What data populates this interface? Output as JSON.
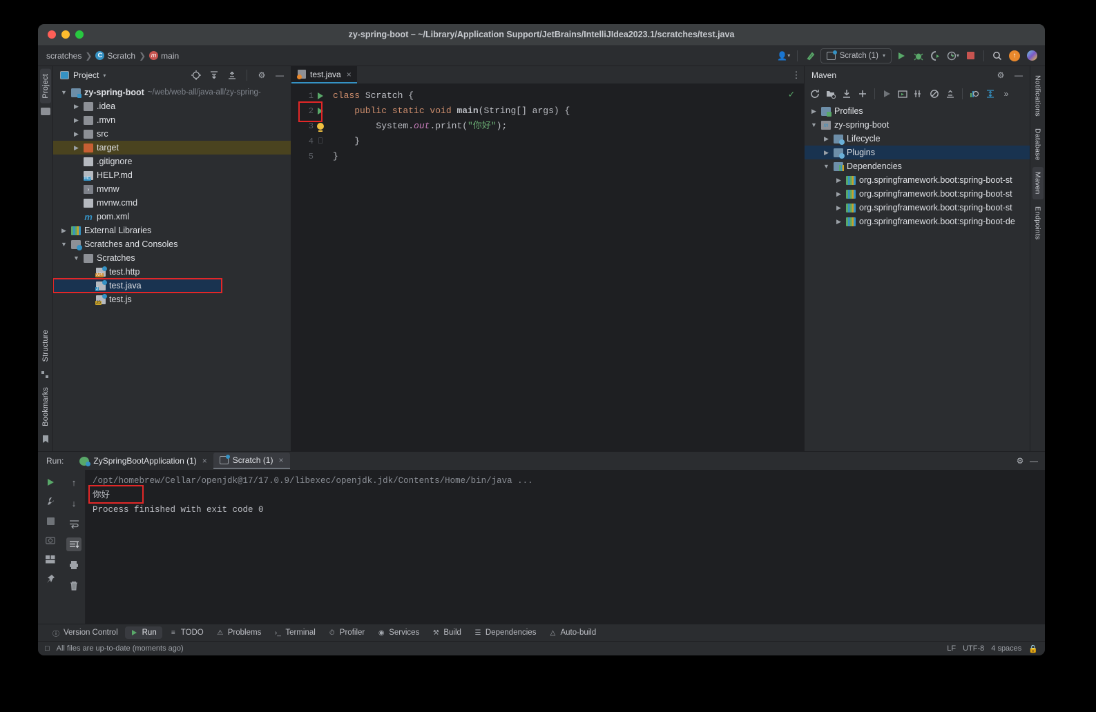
{
  "window": {
    "title": "zy-spring-boot – ~/Library/Application Support/JetBrains/IntelliJIdea2023.1/scratches/test.java"
  },
  "breadcrumbs": [
    {
      "label": "scratches",
      "icon": ""
    },
    {
      "label": "Scratch",
      "icon": "class-icon"
    },
    {
      "label": "main",
      "icon": "method-icon"
    }
  ],
  "toolbar": {
    "run_config": "Scratch (1)",
    "icons": [
      "user-dropdown-icon",
      "build-hammer-icon",
      "run-icon",
      "debug-icon",
      "run-coverage-icon",
      "profiler-icon",
      "stop-icon",
      "search-everywhere-icon",
      "updates-icon",
      "ai-assistant-icon"
    ]
  },
  "left_strip": {
    "tabs": [
      "Project"
    ],
    "bottom_tabs": [
      "Structure",
      "Bookmarks"
    ]
  },
  "right_strip": {
    "tabs": [
      "Notifications",
      "Database",
      "Maven",
      "Endpoints"
    ]
  },
  "project_panel": {
    "title": "Project",
    "toolbar_icons": [
      "select-opened-file-icon",
      "expand-all-icon",
      "collapse-all-icon",
      "settings-gear-icon",
      "hide-icon"
    ],
    "tree": [
      {
        "indent": 0,
        "arrow": "v",
        "icon": "module-icon",
        "label": "zy-spring-boot",
        "bold": true,
        "path": "~/web/web-all/java-all/zy-spring-",
        "state": "normal"
      },
      {
        "indent": 1,
        "arrow": ">",
        "icon": "folder-icon",
        "label": ".idea",
        "state": "normal"
      },
      {
        "indent": 1,
        "arrow": ">",
        "icon": "folder-icon",
        "label": ".mvn",
        "state": "normal"
      },
      {
        "indent": 1,
        "arrow": ">",
        "icon": "folder-icon",
        "label": "src",
        "state": "normal"
      },
      {
        "indent": 1,
        "arrow": ">",
        "icon": "folder-excluded-icon",
        "label": "target",
        "state": "highlighted"
      },
      {
        "indent": 1,
        "arrow": "",
        "icon": "gitignore-icon",
        "label": ".gitignore",
        "state": "normal"
      },
      {
        "indent": 1,
        "arrow": "",
        "icon": "markdown-icon",
        "label": "HELP.md",
        "state": "normal"
      },
      {
        "indent": 1,
        "arrow": "",
        "icon": "shell-script-icon",
        "label": "mvnw",
        "state": "normal"
      },
      {
        "indent": 1,
        "arrow": "",
        "icon": "cmd-script-icon",
        "label": "mvnw.cmd",
        "state": "normal"
      },
      {
        "indent": 1,
        "arrow": "",
        "icon": "maven-xml-icon",
        "label": "pom.xml",
        "state": "normal"
      },
      {
        "indent": 0,
        "arrow": ">",
        "icon": "libraries-icon",
        "label": "External Libraries",
        "state": "normal"
      },
      {
        "indent": 0,
        "arrow": "v",
        "icon": "scratches-root-icon",
        "label": "Scratches and Consoles",
        "state": "normal"
      },
      {
        "indent": 1,
        "arrow": "v",
        "icon": "folder-icon",
        "label": "Scratches",
        "state": "normal"
      },
      {
        "indent": 2,
        "arrow": "",
        "icon": "http-scratch-icon",
        "label": "test.http",
        "tag": "API",
        "state": "normal"
      },
      {
        "indent": 2,
        "arrow": "",
        "icon": "java-scratch-icon",
        "label": "test.java",
        "tag": "J",
        "state": "selected-boxed"
      },
      {
        "indent": 2,
        "arrow": "",
        "icon": "js-scratch-icon",
        "label": "test.js",
        "tag": "JS",
        "state": "normal"
      }
    ]
  },
  "editor": {
    "tab": {
      "label": "test.java",
      "icon": "java-scratch-icon",
      "close": "×"
    },
    "more_icon": "more-vertical-icon",
    "inspection_status": "✓",
    "lines": [
      {
        "num": "1",
        "gutter": "run-gutter-icon",
        "tokens": [
          {
            "t": "class ",
            "c": "kw"
          },
          {
            "t": "Scratch",
            "c": "type"
          },
          {
            "t": " {",
            "c": "txt"
          }
        ]
      },
      {
        "num": "2",
        "gutter": "run-gutter-icon-boxed",
        "tokens": [
          {
            "t": "    public static void ",
            "c": "kw"
          },
          {
            "t": "main",
            "c": "fn"
          },
          {
            "t": "(",
            "c": "txt"
          },
          {
            "t": "String",
            "c": "type"
          },
          {
            "t": "[] args) {",
            "c": "txt"
          }
        ]
      },
      {
        "num": "3",
        "gutter": "intention-bulb-icon",
        "tokens": [
          {
            "t": "        System.",
            "c": "txt"
          },
          {
            "t": "out",
            "c": "fld"
          },
          {
            "t": ".print(",
            "c": "txt"
          },
          {
            "t": "\"你好\"",
            "c": "str"
          },
          {
            "t": ");",
            "c": "txt"
          }
        ]
      },
      {
        "num": "4",
        "gutter": "fold-end-icon",
        "tokens": [
          {
            "t": "    }",
            "c": "txt"
          }
        ]
      },
      {
        "num": "5",
        "gutter": "",
        "tokens": [
          {
            "t": "}",
            "c": "txt"
          }
        ]
      }
    ]
  },
  "maven_panel": {
    "title": "Maven",
    "header_icons": [
      "settings-gear-icon",
      "hide-icon"
    ],
    "toolbar_icons": [
      "reload-icon",
      "add-maven-project-icon",
      "download-sources-icon",
      "add-icon",
      "run-icon",
      "execute-goal-icon",
      "toggle-skip-icon",
      "toggle-offline-icon",
      "collapse-all-icon",
      "show-dependencies-icon",
      "expand-icon",
      "more-icon"
    ],
    "tree": [
      {
        "indent": 0,
        "arrow": ">",
        "icon": "profiles-icon",
        "label": "Profiles",
        "state": "normal"
      },
      {
        "indent": 0,
        "arrow": "v",
        "icon": "maven-project-icon",
        "label": "zy-spring-boot",
        "state": "normal"
      },
      {
        "indent": 1,
        "arrow": ">",
        "icon": "lifecycle-icon",
        "label": "Lifecycle",
        "state": "normal"
      },
      {
        "indent": 1,
        "arrow": ">",
        "icon": "plugins-icon",
        "label": "Plugins",
        "state": "selected"
      },
      {
        "indent": 1,
        "arrow": "v",
        "icon": "dependencies-icon",
        "label": "Dependencies",
        "state": "normal"
      },
      {
        "indent": 2,
        "arrow": ">",
        "icon": "library-icon",
        "label": "org.springframework.boot:spring-boot-st",
        "state": "normal"
      },
      {
        "indent": 2,
        "arrow": ">",
        "icon": "library-icon",
        "label": "org.springframework.boot:spring-boot-st",
        "state": "normal"
      },
      {
        "indent": 2,
        "arrow": ">",
        "icon": "library-icon",
        "label": "org.springframework.boot:spring-boot-st",
        "state": "normal"
      },
      {
        "indent": 2,
        "arrow": ">",
        "icon": "library-icon",
        "label": "org.springframework.boot:spring-boot-de",
        "state": "normal"
      }
    ]
  },
  "run_panel": {
    "label": "Run:",
    "tabs": [
      {
        "label": "ZySpringBootApplication (1)",
        "icon": "spring-boot-icon",
        "close": "×",
        "selected": false
      },
      {
        "label": "Scratch (1)",
        "icon": "scratch-run-icon",
        "close": "×",
        "selected": true
      }
    ],
    "header_icons": [
      "settings-gear-icon",
      "hide-icon"
    ],
    "side_icons": [
      "rerun-icon",
      "wrench-icon",
      "stop-icon",
      "camera-icon",
      "layout-icon",
      "pin-icon"
    ],
    "side_icons2": [
      "scroll-up-icon",
      "scroll-down-icon",
      "soft-wrap-icon",
      "scroll-to-end-icon",
      "print-icon",
      "clear-all-icon"
    ],
    "console": [
      {
        "text": "/opt/homebrew/Cellar/openjdk@17/17.0.9/libexec/openjdk.jdk/Contents/Home/bin/java ...",
        "style": "path"
      },
      {
        "text": "你好",
        "style": "out",
        "boxed": true
      },
      {
        "text": "Process finished with exit code 0",
        "style": "out"
      }
    ]
  },
  "bottom_tabs": [
    {
      "label": "Version Control",
      "icon": "branch-icon",
      "selected": false
    },
    {
      "label": "Run",
      "icon": "run-icon",
      "selected": true
    },
    {
      "label": "TODO",
      "icon": "todo-icon",
      "selected": false
    },
    {
      "label": "Problems",
      "icon": "problems-icon",
      "selected": false
    },
    {
      "label": "Terminal",
      "icon": "terminal-icon",
      "selected": false
    },
    {
      "label": "Profiler",
      "icon": "profiler-icon",
      "selected": false
    },
    {
      "label": "Services",
      "icon": "services-icon",
      "selected": false
    },
    {
      "label": "Build",
      "icon": "build-hammer-icon",
      "selected": false
    },
    {
      "label": "Dependencies",
      "icon": "dependencies-icon",
      "selected": false
    },
    {
      "label": "Auto-build",
      "icon": "warning-icon",
      "selected": false
    }
  ],
  "status_bar": {
    "left_icon": "layout-icon",
    "message": "All files are up-to-date (moments ago)",
    "line_separator": "LF",
    "encoding": "UTF-8",
    "indent": "4 spaces",
    "lock_icon": "🔒"
  },
  "colors": {
    "accent": "#3592c4",
    "run_green": "#59a869",
    "highlight_red": "#e32727",
    "selection_blue": "#193350"
  }
}
